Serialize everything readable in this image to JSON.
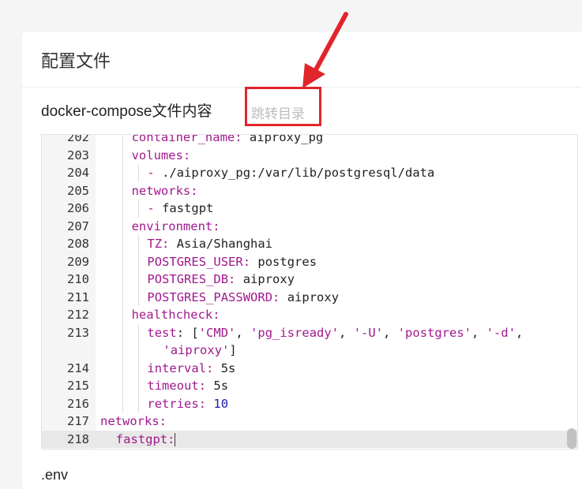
{
  "card": {
    "title": "配置文件",
    "section_heading": "docker-compose文件内容",
    "jump_link": "跳转目录",
    "next_section_label": ".env"
  },
  "editor": {
    "lines": [
      {
        "num": "202",
        "indent": 2,
        "key": "container_name",
        "rest": " aiproxy_pg"
      },
      {
        "num": "203",
        "indent": 2,
        "key": "volumes",
        "rest": ""
      },
      {
        "num": "204",
        "indent": 3,
        "dash": true,
        "rest": "./aiproxy_pg:/var/lib/postgresql/data"
      },
      {
        "num": "205",
        "indent": 2,
        "key": "networks",
        "rest": ""
      },
      {
        "num": "206",
        "indent": 3,
        "dash": true,
        "rest": "fastgpt"
      },
      {
        "num": "207",
        "indent": 2,
        "key": "environment",
        "rest": ""
      },
      {
        "num": "208",
        "indent": 3,
        "key": "TZ",
        "rest": " Asia/Shanghai"
      },
      {
        "num": "209",
        "indent": 3,
        "key": "POSTGRES_USER",
        "rest": " postgres"
      },
      {
        "num": "210",
        "indent": 3,
        "key": "POSTGRES_DB",
        "rest": " aiproxy"
      },
      {
        "num": "211",
        "indent": 3,
        "key": "POSTGRES_PASSWORD",
        "rest": " aiproxy"
      },
      {
        "num": "212",
        "indent": 2,
        "key": "healthcheck",
        "rest": ""
      },
      {
        "num": "213",
        "indent": 3,
        "key": "test",
        "array": [
          "'CMD'",
          "'pg_isready'",
          "'-U'",
          "'postgres'",
          "'-d'"
        ]
      },
      {
        "num": "",
        "indent": 3,
        "wrap": true,
        "array_cont": [
          "'aiproxy'"
        ]
      },
      {
        "num": "214",
        "indent": 3,
        "key": "interval",
        "rest": " 5s"
      },
      {
        "num": "215",
        "indent": 3,
        "key": "timeout",
        "rest": " 5s"
      },
      {
        "num": "216",
        "indent": 3,
        "key": "retries",
        "num_val": " 10"
      },
      {
        "num": "217",
        "indent": 0,
        "key": "networks",
        "rest": ""
      },
      {
        "num": "218",
        "indent": 1,
        "key": "fastgpt",
        "rest": "",
        "active": true,
        "cursor": true
      }
    ]
  },
  "colors": {
    "key": "#a0198d",
    "number": "#1c1ca8",
    "highlight_border": "#e0252b",
    "arrow": "#e0252b"
  }
}
